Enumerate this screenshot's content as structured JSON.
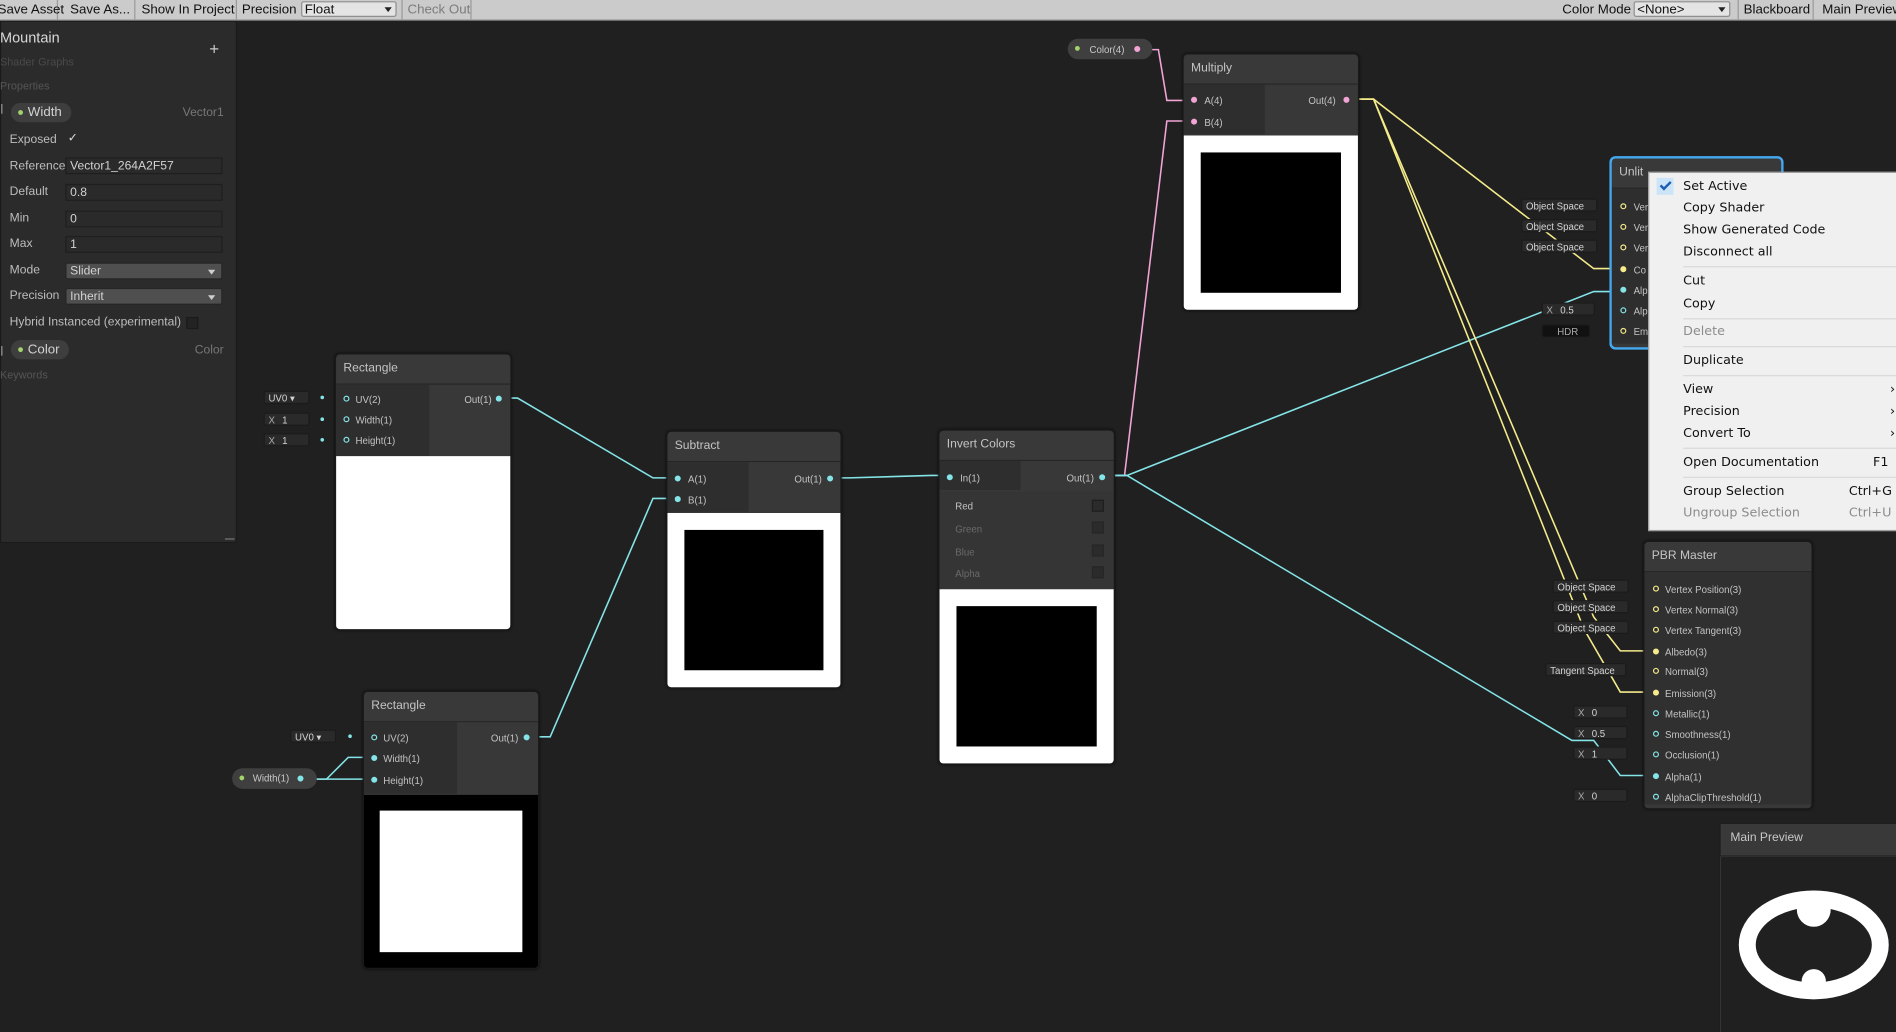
{
  "toolbar": {
    "save_asset": "Save Asset",
    "save_as": "Save As...",
    "show_in_project": "Show In Project",
    "precision_label": "Precision",
    "precision_value": "Float",
    "check_out": "Check Out",
    "color_mode_label": "Color Mode",
    "color_mode_value": "<None>",
    "blackboard": "Blackboard",
    "main_preview": "Main Preview"
  },
  "blackboard": {
    "title": "Mountain",
    "subtitle": "Shader Graphs",
    "add_symbol": "+",
    "properties_header": "Properties",
    "keywords_header": "Keywords",
    "width_property": {
      "name": "Width",
      "type": "Vector1",
      "exposed_label": "Exposed",
      "exposed_value": "✓",
      "reference_label": "Reference",
      "reference_value": "Vector1_264A2F57",
      "default_label": "Default",
      "default_value": "0.8",
      "min_label": "Min",
      "min_value": "0",
      "max_label": "Max",
      "max_value": "1",
      "mode_label": "Mode",
      "mode_value": "Slider",
      "precision_label": "Precision",
      "precision_value": "Inherit",
      "hybrid_label": "Hybrid Instanced (experimental)"
    },
    "color_property": {
      "name": "Color",
      "type": "Color"
    }
  },
  "nodes": {
    "rectangle1": {
      "title": "Rectangle",
      "inputs": [
        "UV(2)",
        "Width(1)",
        "Height(1)"
      ],
      "output": "Out(1)",
      "uv_field": "UV0",
      "width_field_x": "X",
      "width_field": "1",
      "height_field_x": "X",
      "height_field": "1"
    },
    "rectangle2": {
      "title": "Rectangle",
      "inputs": [
        "UV(2)",
        "Width(1)",
        "Height(1)"
      ],
      "output": "Out(1)",
      "uv_field": "UV0",
      "width_property_node": "Width(1)"
    },
    "subtract": {
      "title": "Subtract",
      "inputs": [
        "A(1)",
        "B(1)"
      ],
      "output": "Out(1)"
    },
    "invert": {
      "title": "Invert Colors",
      "inputs": [
        "In(1)"
      ],
      "output": "Out(1)",
      "channels": [
        "Red",
        "Green",
        "Blue",
        "Alpha"
      ]
    },
    "multiply": {
      "title": "Multiply",
      "inputs": [
        "A(4)",
        "B(4)"
      ],
      "output": "Out(4)",
      "color_property_node": "Color(4)"
    },
    "unlit": {
      "title": "Unlit",
      "port_stubs": [
        "Ver",
        "Ver",
        "Ver",
        "Co",
        "Alp",
        "Alp",
        "Em"
      ],
      "space_fields": [
        "Object Space",
        "Object Space",
        "Object Space"
      ],
      "alpha_x": "X",
      "alpha_value": "0.5",
      "hdr_label": "HDR"
    },
    "pbr": {
      "title": "PBR Master",
      "inputs": [
        "Vertex Position(3)",
        "Vertex Normal(3)",
        "Vertex Tangent(3)",
        "Albedo(3)",
        "Normal(3)",
        "Emission(3)",
        "Metallic(1)",
        "Smoothness(1)",
        "Occlusion(1)",
        "Alpha(1)",
        "AlphaClipThreshold(1)"
      ],
      "space_fields": [
        "Object Space",
        "Object Space",
        "Object Space",
        "Tangent Space"
      ],
      "value_x": "X",
      "values": [
        "0",
        "0.5",
        "1",
        "0"
      ]
    }
  },
  "context_menu": {
    "items": [
      {
        "label": "Set Active",
        "checked": true
      },
      {
        "label": "Copy Shader"
      },
      {
        "label": "Show Generated Code"
      },
      {
        "label": "Disconnect all"
      },
      {
        "label": "Cut"
      },
      {
        "label": "Copy"
      },
      {
        "label": "Delete",
        "disabled": true
      },
      {
        "label": "Duplicate"
      },
      {
        "label": "View",
        "submenu": "›"
      },
      {
        "label": "Precision",
        "submenu": "›"
      },
      {
        "label": "Convert To",
        "submenu": "›"
      },
      {
        "label": "Open Documentation",
        "shortcut": "F1"
      },
      {
        "label": "Group Selection",
        "shortcut": "Ctrl+G"
      },
      {
        "label": "Ungroup Selection",
        "shortcut": "Ctrl+U",
        "disabled": true
      }
    ]
  },
  "main_preview_panel": {
    "title": "Main Preview"
  },
  "colors": {
    "wire_float": "#84e4e7",
    "wire_vector4": "#f1a4d5",
    "wire_vector3": "#f5eb8b",
    "property_dot": "#a4d36c",
    "selection_outline": "#44a9f0",
    "graph_background": "#202020"
  }
}
